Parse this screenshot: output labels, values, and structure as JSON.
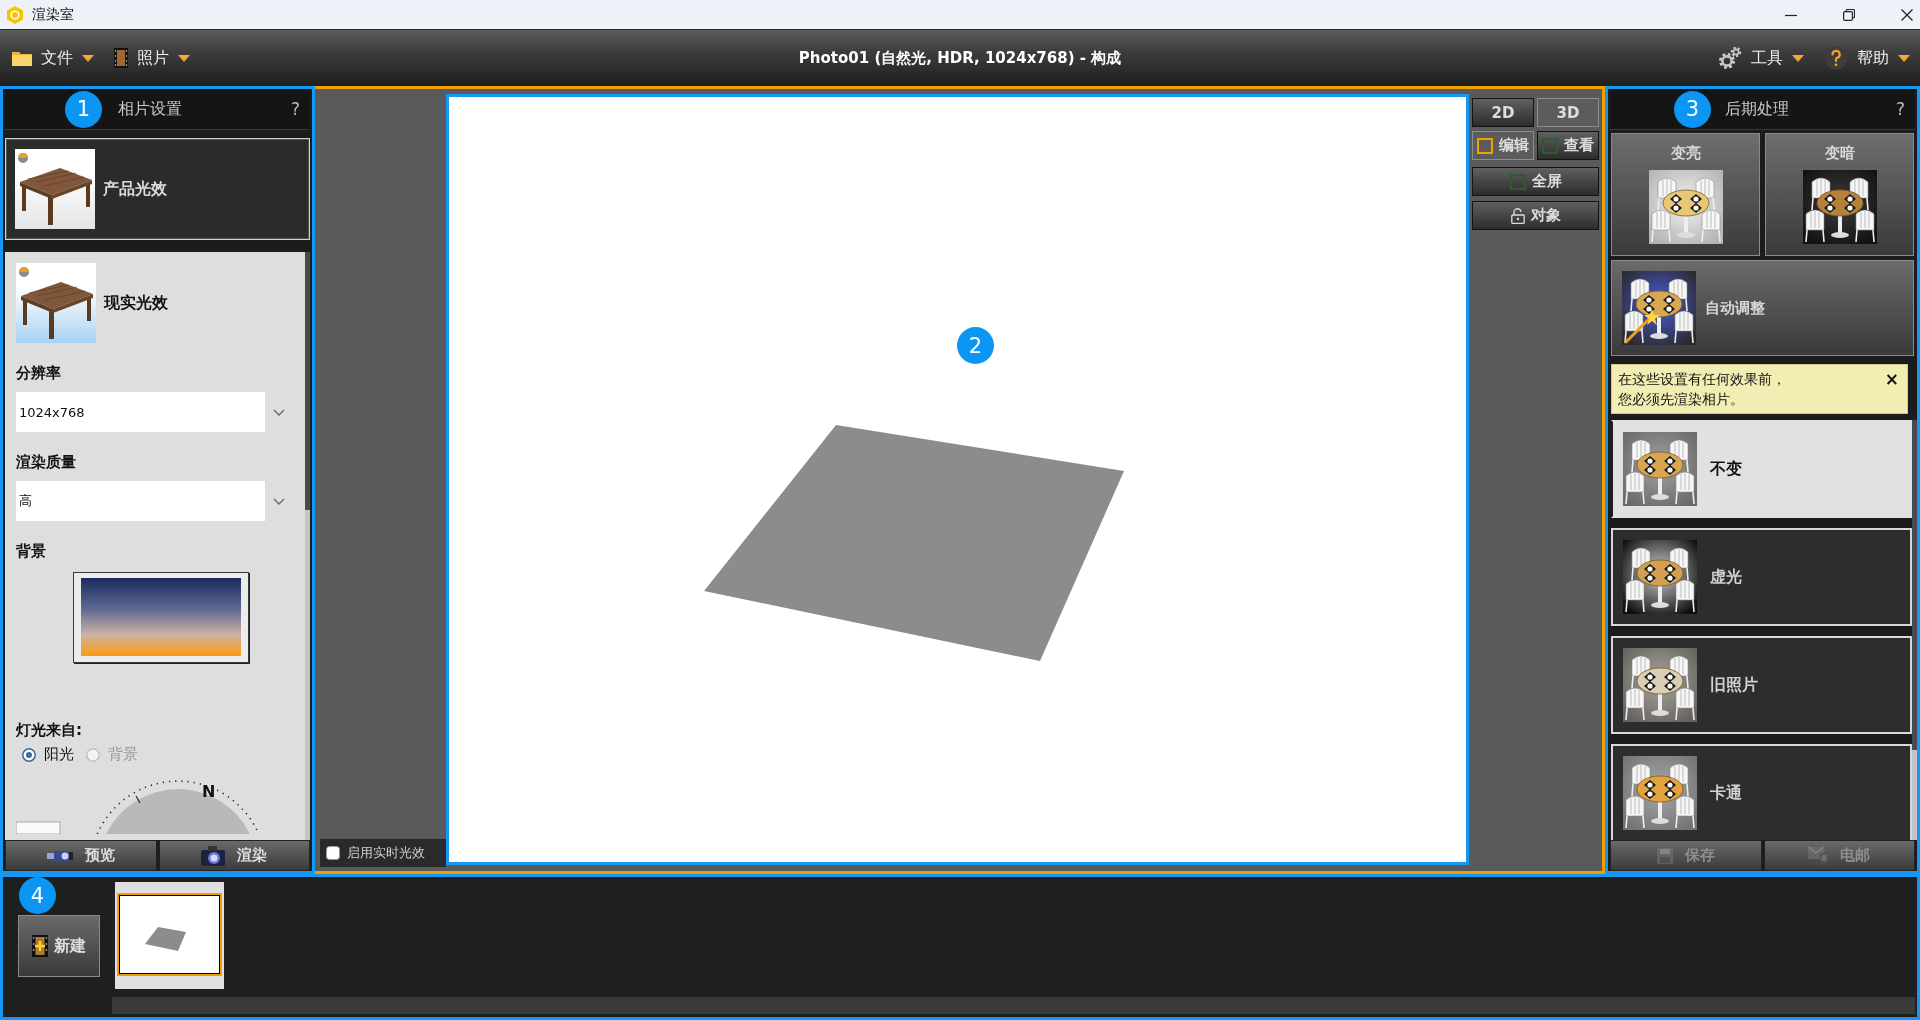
{
  "window": {
    "title": "渲染室"
  },
  "toolbar": {
    "menus": [
      {
        "label": "文件",
        "kind": "folder"
      },
      {
        "label": "照片",
        "kind": "film"
      }
    ],
    "title": "Photo01 (自然光, HDR, 1024x768) - 构成",
    "tools": [
      {
        "label": "工具",
        "kind": "gears"
      },
      {
        "label": "帮助",
        "kind": "help"
      }
    ]
  },
  "photo_settings": {
    "callout": "1",
    "title": "相片设置",
    "help": "?",
    "lighting_modes": [
      {
        "label": "产品光效",
        "kind": "product",
        "selected": false
      },
      {
        "label": "现实光效",
        "kind": "realistic",
        "selected": true
      }
    ],
    "resolution": {
      "label": "分辨率",
      "value": "1024x768"
    },
    "quality": {
      "label": "渲染质量",
      "value": "高"
    },
    "background": {
      "label": "背景"
    },
    "light_source": {
      "label": "灯光来自:",
      "options": [
        {
          "label": "阳光",
          "selected": true,
          "disabled": false
        },
        {
          "label": "背景",
          "selected": false,
          "disabled": true
        }
      ]
    },
    "compass": {
      "north": "N"
    },
    "buttons": [
      {
        "label": "预览",
        "kind": "preview"
      },
      {
        "label": "渲染",
        "kind": "render"
      }
    ]
  },
  "viewport": {
    "callout": "2",
    "view_modes": [
      {
        "label": "2D",
        "selected": false
      },
      {
        "label": "3D",
        "selected": true
      }
    ],
    "tool_modes": [
      {
        "label": "编辑",
        "selected": true
      },
      {
        "label": "查看",
        "selected": false
      }
    ],
    "fullscreen": {
      "label": "全屏",
      "on": false
    },
    "objects": {
      "label": "对象"
    },
    "realtime_lighting": {
      "label": "启用实时光效",
      "checked": false
    }
  },
  "post_processing": {
    "callout": "3",
    "title": "后期处理",
    "help": "?",
    "adjustments": [
      {
        "label": "变亮",
        "kind": "brighten"
      },
      {
        "label": "变暗",
        "kind": "darken"
      }
    ],
    "auto_adjust": {
      "label": "自动调整"
    },
    "notice": {
      "text": "在这些设置有任何效果前，您必须先渲染相片。",
      "close": "×"
    },
    "effects": [
      {
        "label": "不变",
        "kind": "normal",
        "selected": true
      },
      {
        "label": "虚光",
        "kind": "vignette",
        "selected": false
      },
      {
        "label": "旧照片",
        "kind": "sepia",
        "selected": false
      },
      {
        "label": "卡通",
        "kind": "cartoon",
        "selected": false
      }
    ],
    "buttons": [
      {
        "label": "保存",
        "kind": "save",
        "disabled": true
      },
      {
        "label": "电邮",
        "kind": "email",
        "disabled": true
      }
    ]
  },
  "gallery": {
    "callout": "4",
    "new_button": {
      "label": "新建"
    },
    "photos": [
      {
        "selected": true
      }
    ]
  }
}
